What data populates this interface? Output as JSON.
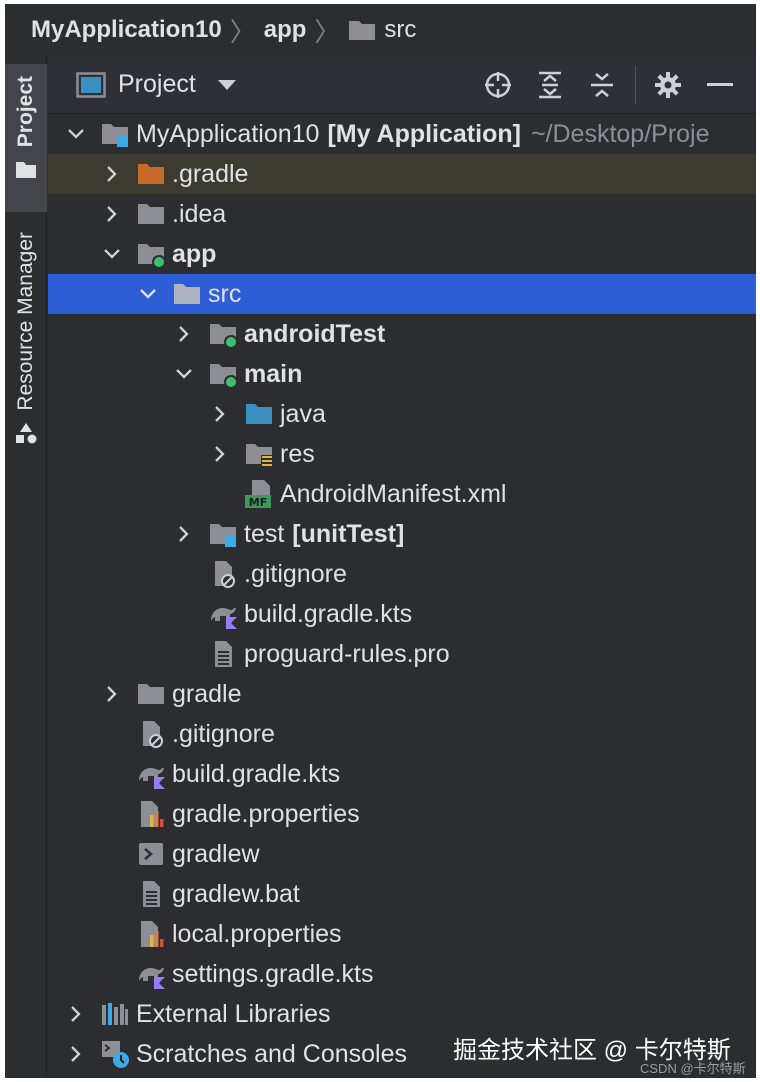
{
  "breadcrumb": {
    "project": "MyApplication10",
    "module": "app",
    "folder": "src"
  },
  "side_stripe": {
    "project_tab": "Project",
    "resource_tab": "Resource Manager"
  },
  "toolbar": {
    "title": "Project"
  },
  "tree": {
    "root": {
      "label": "MyApplication10",
      "module": "[My Application]",
      "path": "~/Desktop/Proje"
    },
    "gradle_dir": ".gradle",
    "idea": ".idea",
    "app": "app",
    "src": "src",
    "androidTest": "androidTest",
    "main": "main",
    "java": "java",
    "res": "res",
    "manifest": "AndroidManifest.xml",
    "manifest_badge": "MF",
    "test": "test",
    "test_tag": "[unitTest]",
    "app_gitignore": ".gitignore",
    "app_build": "build.gradle.kts",
    "proguard": "proguard-rules.pro",
    "gradle": "gradle",
    "gitignore": ".gitignore",
    "build": "build.gradle.kts",
    "gradle_props": "gradle.properties",
    "gradlew": "gradlew",
    "gradlew_bat": "gradlew.bat",
    "local_props": "local.properties",
    "settings": "settings.gradle.kts",
    "ext_libs": "External Libraries",
    "scratches": "Scratches and Consoles"
  },
  "watermark": "掘金技术社区 @ 卡尔特斯",
  "credit": "CSDN @卡尔特斯",
  "colors": {
    "background": "#2b2d30",
    "selection": "#2e5ed6",
    "highlight_row": "#3d3a2f",
    "folder": "#8c8f96",
    "excluded_folder": "#c96a2a",
    "source_folder": "#3c8fc1",
    "module_dot": "#3fbf6f",
    "test_marker": "#3fa9e6"
  }
}
